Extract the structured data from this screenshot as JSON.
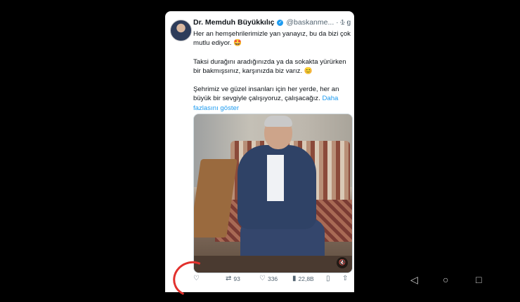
{
  "tweet": {
    "author_name": "Dr. Memduh Büyükkılıç",
    "handle": "@baskanme...",
    "separator": "·",
    "time": "1 g",
    "more_label": "···",
    "paragraphs": [
      "Her an hemşehrilerimizle yan yanayız, bu da bizi çok mutlu ediyor. 🤩",
      "Taksi durağını aradığınızda ya da sokakta yürürken bir bakmışsınız, karşınızda biz varız. 😊",
      "Şehrimiz ve güzel insanları için her yerde, her an büyük bir sevgiyle çalışıyoruz, çalışacağız."
    ],
    "show_more": "Daha fazlasını göster"
  },
  "actions": {
    "reply_count": "",
    "retweet_count": "93",
    "like_count": "336",
    "views_count": "22,8B"
  },
  "icons": {
    "reply": "reply-icon",
    "retweet": "retweet-icon",
    "like": "heart-icon",
    "views": "views-icon",
    "bookmark": "bookmark-icon",
    "share": "share-icon",
    "mute": "speaker-muted-icon",
    "verified": "verified-badge-icon"
  },
  "colors": {
    "link": "#1d9bf0",
    "verified": "#1d9bf0",
    "annotation_circle": "#e2312d",
    "background": "#000000"
  }
}
